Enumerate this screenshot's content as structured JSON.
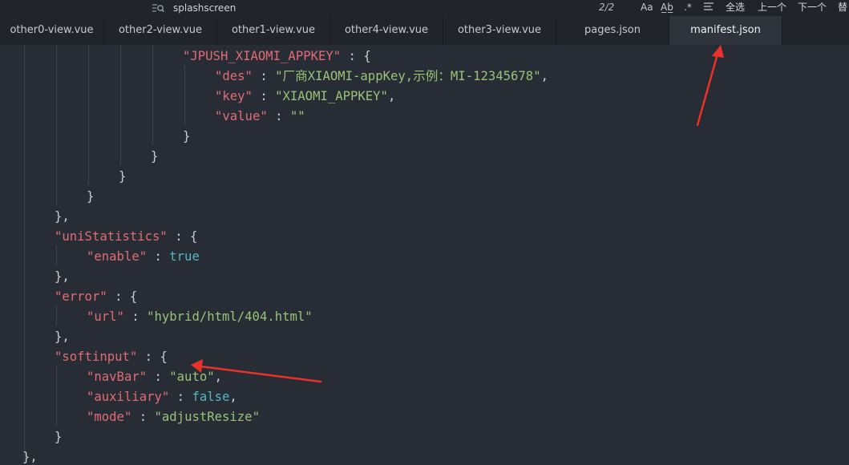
{
  "find": {
    "query": "splashscreen",
    "count": "2/2",
    "opt_case": "Aa",
    "opt_word": "A̲b̲",
    "opt_regex": ".*",
    "select_all": "全选",
    "prev": "上一个",
    "next": "下一个",
    "replace": "替"
  },
  "tabs": [
    {
      "label": "other0-view.vue"
    },
    {
      "label": "other2-view.vue"
    },
    {
      "label": "other1-view.vue"
    },
    {
      "label": "other4-view.vue"
    },
    {
      "label": "other3-view.vue"
    },
    {
      "label": "pages.json"
    },
    {
      "label": "manifest.json"
    }
  ],
  "code": [
    [
      {
        "t": "\"JPUSH_XIAOMI_APPKEY\"",
        "c": "k"
      },
      {
        "t": " : {",
        "c": "p"
      }
    ],
    [
      {
        "t": "\"des\"",
        "c": "k"
      },
      {
        "t": " : ",
        "c": "p"
      },
      {
        "t": "\"厂商XIAOMI-appKey,示例：MI-12345678\"",
        "c": "s"
      },
      {
        "t": ",",
        "c": "p"
      }
    ],
    [
      {
        "t": "\"key\"",
        "c": "k"
      },
      {
        "t": " : ",
        "c": "p"
      },
      {
        "t": "\"XIAOMI_APPKEY\"",
        "c": "s"
      },
      {
        "t": ",",
        "c": "p"
      }
    ],
    [
      {
        "t": "\"value\"",
        "c": "k"
      },
      {
        "t": " : ",
        "c": "p"
      },
      {
        "t": "\"\"",
        "c": "s"
      }
    ],
    [
      {
        "t": "}",
        "c": "p"
      }
    ],
    [
      {
        "t": "}",
        "c": "p"
      }
    ],
    [
      {
        "t": "}",
        "c": "p"
      }
    ],
    [
      {
        "t": "}",
        "c": "p"
      }
    ],
    [
      {
        "t": "},",
        "c": "p"
      }
    ],
    [
      {
        "t": "\"uniStatistics\"",
        "c": "k"
      },
      {
        "t": " : {",
        "c": "p"
      }
    ],
    [
      {
        "t": "\"enable\"",
        "c": "k"
      },
      {
        "t": " : ",
        "c": "p"
      },
      {
        "t": "true",
        "c": "b"
      }
    ],
    [
      {
        "t": "},",
        "c": "p"
      }
    ],
    [
      {
        "t": "\"error\"",
        "c": "k"
      },
      {
        "t": " : {",
        "c": "p"
      }
    ],
    [
      {
        "t": "\"url\"",
        "c": "k"
      },
      {
        "t": " : ",
        "c": "p"
      },
      {
        "t": "\"hybrid/html/404.html\"",
        "c": "s"
      }
    ],
    [
      {
        "t": "},",
        "c": "p"
      }
    ],
    [
      {
        "t": "\"softinput\"",
        "c": "k"
      },
      {
        "t": " : {",
        "c": "p"
      }
    ],
    [
      {
        "t": "\"navBar\"",
        "c": "k"
      },
      {
        "t": " : ",
        "c": "p"
      },
      {
        "t": "\"auto\"",
        "c": "s"
      },
      {
        "t": ",",
        "c": "p"
      }
    ],
    [
      {
        "t": "\"auxiliary\"",
        "c": "k"
      },
      {
        "t": " : ",
        "c": "p"
      },
      {
        "t": "false",
        "c": "b"
      },
      {
        "t": ",",
        "c": "p"
      }
    ],
    [
      {
        "t": "\"mode\"",
        "c": "k"
      },
      {
        "t": " : ",
        "c": "p"
      },
      {
        "t": "\"adjustResize\"",
        "c": "s"
      }
    ],
    [
      {
        "t": "}",
        "c": "p"
      }
    ],
    [
      {
        "t": "},",
        "c": "p"
      }
    ]
  ],
  "colors": {
    "key": "#e06c75",
    "string": "#98c379",
    "boolean": "#56b6c2",
    "punctuation": "#c9ccd1",
    "annotation_arrow": "#e8322b"
  },
  "icons": {
    "find": "search-icon",
    "arrow_a": "annotation-arrow-icon",
    "arrow_b": "annotation-arrow-icon"
  }
}
